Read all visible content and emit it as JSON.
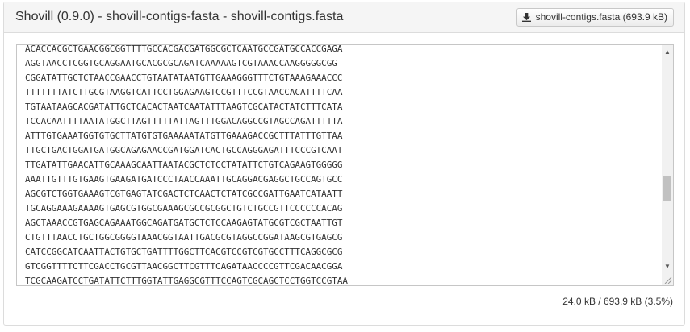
{
  "header": {
    "title": "Shovill (0.9.0) - shovill-contigs-fasta - shovill-contigs.fasta",
    "download_label": "shovill-contigs.fasta (693.9 kB)",
    "download_icon": "download-icon"
  },
  "content": {
    "lines": [
      "ACACCACGCTGAACGGCGGTTTTGCCACGACGATGGCGCTCAATGCCGATGCCACCGAGA",
      "AGGTAACCTCGGTGCAGGAATGCACGCGCAGATCAAAAAGTCGTAAACCAAGGGGGCGG",
      "CGGATATTGCTCTAACCGAACCTGTAATATAATGTTGAAAGGGTTTCTGTAAAGAAACCC",
      "TTTTTTTATCTTGCGTAAGGTCATTCCTGGAGAAGTCCGTTTCCGTAACCACATTTTCAA",
      "TGTAATAAGCACGATATTGCTCACACTAATCAATATTTAAGTCGCATACTATCTTTCATA",
      "TCCACAATTTTAATATGGCTTAGTTTTTATTAGTTTGGACAGGCCGTAGCCAGATTTTTA",
      "ATTTGTGAAATGGTGTGCTTATGTGTGAAAAATATGTTGAAAGACCGCTTTATTTGTTAA",
      "TTGCTGACTGGATGATGGCAGAGAACCGATGGATCACTGCCAGGGAGATTTCCCGTCAAT",
      "TTGATATTGAACATTGCAAAGCAATTAATACGCTCTCCTATATTCTGTCAGAAGTGGGGG",
      "AAATTGTTTGTGAAGTGAAGATGATCCCTAACCAAATTGCAGGACGAGGCTGCCAGTGCC",
      "AGCGTCTGGTGAAAGTCGTGAGTATCGACTCTCAACTCTATCGCCGATTGAATCATAATT",
      "TGCAGGAAAGAAAAGTGAGCGTGGCGAAAGCGCCGCGGCTGTCTGCCGTTCCCCCCACAG",
      "AGCTAAACCGTGAGCAGAAATGGCAGATGATGCTCTCCAAGAGTATGCGTCGCTAATTGT",
      "CTGTTTAACCTGCTGGCGGGGTAAACGGTAATTGACGCGTAGGCCGGATAAGCGTGAGCG",
      "CATCCGGCATCAATTACTGTGCTGATTTTGGCTTCACGTCCGTCGTGCCTTTCAGGCGCG",
      "GTCGGTTTTCTTCGACCTGCGTTAACGGCTTCGTTTCAGATAACCCCGTTCGACAACGGA",
      "TCGCAAGATCCTGATATTCTTTGGTATTGAGGCGTTTCCAGTCGCAGCTCCTGGTCCGTAA"
    ]
  },
  "scrollbar": {
    "up_arrow": "▲",
    "down_arrow": "▼",
    "position_fraction": 0.55
  },
  "footer": {
    "status": "24.0 kB / 693.9 kB (3.5%)"
  }
}
